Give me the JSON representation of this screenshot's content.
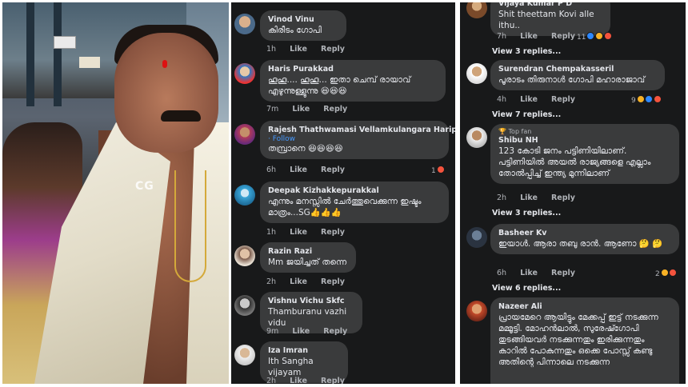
{
  "photo": {
    "watermark": "CG"
  },
  "middle": {
    "comments": [
      {
        "name": "Vinod Vinu",
        "text": "കിരീടം ഗോപി",
        "time": "1h",
        "like": "Like",
        "reply": "Reply"
      },
      {
        "name": "Haris Purakkad",
        "text": "ഹൂഹൂ.... ഹൂഹൂ... ഇതാ ചെമ്പ് രായാവ് എഴുന്നുള്ളുന്നു 😆😆😆",
        "time": "7m",
        "like": "Like",
        "reply": "Reply"
      },
      {
        "name": "Rajesh Thathwamasi Vellamkulangara Haripad",
        "follow": "· Follow",
        "text": "തമ്പ്രാനെ 😆😆😆😆",
        "time": "6h",
        "like": "Like",
        "reply": "Reply",
        "reactions": "1"
      },
      {
        "name": "Deepak Kizhakkepurakkal",
        "text": "എന്നും മനസ്സിൽ ചേർത്തുവെക്കുന്ന ഇഷ്ടം മാത്രം...SG👍👍👍",
        "time": "1h",
        "like": "Like",
        "reply": "Reply"
      },
      {
        "name": "Razin Razi",
        "text": "Mm ജയിച്ചത് തന്നെ",
        "time": "2h",
        "like": "Like",
        "reply": "Reply"
      },
      {
        "name": "Vishnu Vichu Skfc",
        "text": "Thamburanu vazhi vidu",
        "time": "9m",
        "like": "Like",
        "reply": "Reply"
      },
      {
        "name": "Iza Imran",
        "text": "Ith Sangha vijayam",
        "time": "2h",
        "like": "Like",
        "reply": "Reply"
      }
    ]
  },
  "right": {
    "comments": [
      {
        "name": "Vijaya Kumar P D",
        "text": "Shit theettam Kovi alle ithu..",
        "time": "7h",
        "like": "Like",
        "reply": "Reply",
        "reactions": "11",
        "replies": "View 3 replies..."
      },
      {
        "name": "Surendran Chempakasseril",
        "text": "പൂരാടം തിരുനാൾ ഗോപി മഹാരാജാവ്",
        "time": "4h",
        "like": "Like",
        "reply": "Reply",
        "reactions": "9",
        "replies": "View 7 replies..."
      },
      {
        "name": "Shibu NH",
        "badge": "Top fan",
        "text": "123 കോടി ജനം പട്ടിണിയിലാണ്. പട്ടിണിയിൽ അയൽ രാജ്യങ്ങളെ എല്ലാം തോൽപ്പിച്ച് ഇന്ത്യ മുന്നിലാണ്",
        "time": "2h",
        "like": "Like",
        "reply": "Reply",
        "replies": "View 3 replies..."
      },
      {
        "name": "Basheer Kv",
        "text": "ഇയാൾ. ആരാ   തബു രാൻ. ആണോ 🤔 🤔",
        "time": "6h",
        "like": "Like",
        "reply": "Reply",
        "reactions": "2",
        "replies": "View 6 replies..."
      },
      {
        "name": "Nazeer Ali",
        "text": "പ്രായമേറെ ആയിട്ടും മേക്കപ്പ് ഇട്ട് നടക്കുന്ന മമ്മൂട്ടി. മോഹൻലാൽ, സുരേഷ്ഗോപി തുടങ്ങിയവർ നടക്കുന്നതും ഇരിക്കുന്നതും കാറിൽ പോകുന്നതും ഒക്കെ പോസ്സ് കണ്ടു അതിന്റെ പിന്നാലെ നടക്കുന്ന"
      }
    ]
  }
}
